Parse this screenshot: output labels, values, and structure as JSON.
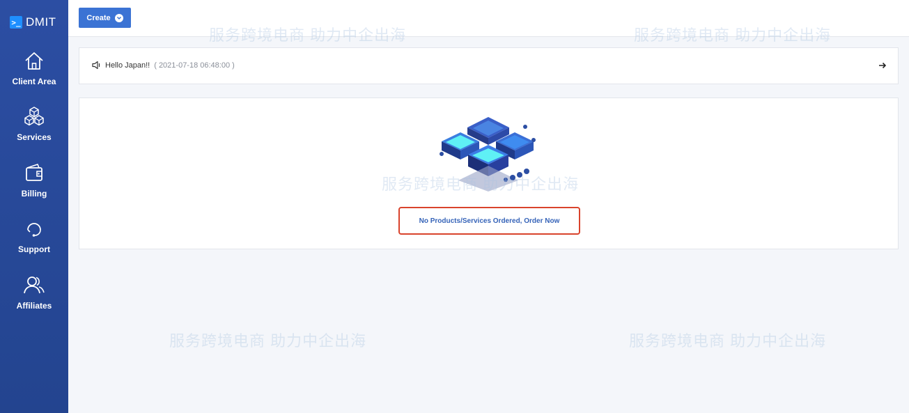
{
  "brand": {
    "logo_glyph": ">_",
    "name": "DMIT"
  },
  "sidebar": {
    "items": [
      {
        "label": "Client Area",
        "icon": "home-icon"
      },
      {
        "label": "Services",
        "icon": "cubes-icon"
      },
      {
        "label": "Billing",
        "icon": "wallet-icon"
      },
      {
        "label": "Support",
        "icon": "headset-icon"
      },
      {
        "label": "Affiliates",
        "icon": "users-icon"
      }
    ]
  },
  "toolbar": {
    "create_label": "Create"
  },
  "announcement": {
    "text": "Hello Japan!!",
    "date": "( 2021-07-18 06:48:00 )"
  },
  "main": {
    "empty_state_link": "No Products/Services Ordered, Order Now"
  },
  "watermark": {
    "sub_text": "服务跨境电商 助力中企出海"
  },
  "colors": {
    "sidebar": "#2c4ea3",
    "primary_button": "#3b73d4",
    "highlight_border": "#d9432c",
    "link": "#3563b8"
  }
}
